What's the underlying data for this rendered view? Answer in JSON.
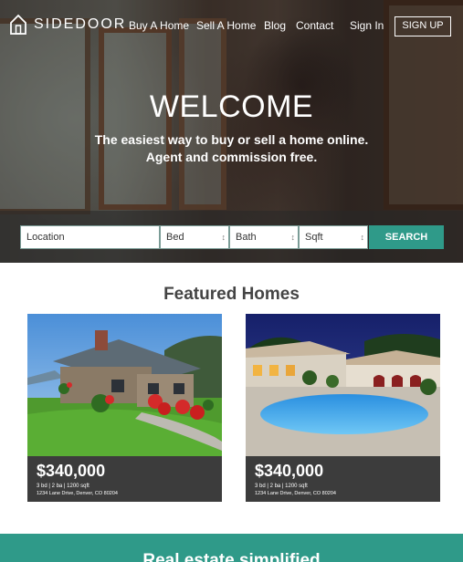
{
  "nav": {
    "logo_text": "SIDEDOOR",
    "links": [
      "Buy A Home",
      "Sell A Home",
      "Blog",
      "Contact"
    ],
    "sign_in": "Sign In",
    "sign_up": "SIGN UP"
  },
  "hero": {
    "title": "WELCOME",
    "tagline_line1": "The easiest way to buy or sell a home online.",
    "tagline_line2": "Agent and commission free."
  },
  "search": {
    "location": "Location",
    "bed": "Bed",
    "bath": "Bath",
    "sqft": "Sqft",
    "button": "SEARCH"
  },
  "featured": {
    "title": "Featured Homes",
    "homes": [
      {
        "price": "$340,000",
        "specs": "3 bd  |  2 ba  |  1200 sqft",
        "address": "1234 Lane Drive, Denver, CO 80204"
      },
      {
        "price": "$340,000",
        "specs": "3 bd  |  2 ba  |  1200 sqft",
        "address": "1234 Lane Drive, Denver, CO 80204"
      }
    ]
  },
  "band": {
    "title": "Real estate simplified"
  },
  "colors": {
    "accent": "#2f9a89",
    "card_info": "#3c3c3c"
  }
}
